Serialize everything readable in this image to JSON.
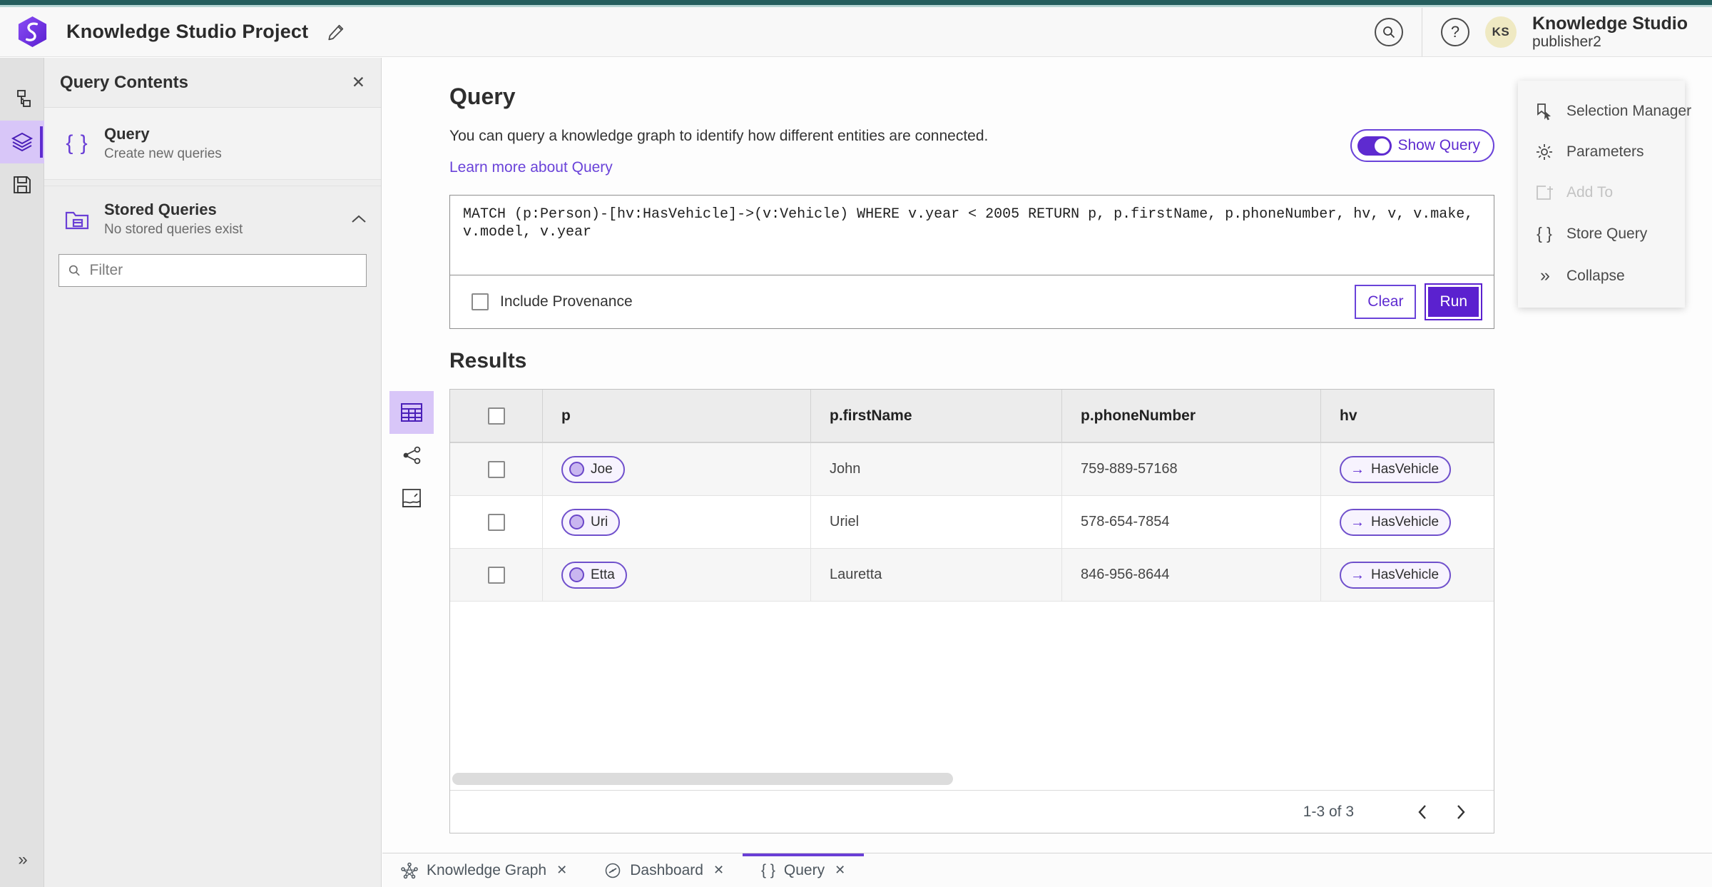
{
  "header": {
    "app_title": "Knowledge Studio Project",
    "user": {
      "initials": "KS",
      "org": "Knowledge Studio",
      "name": "publisher2"
    }
  },
  "panel": {
    "title": "Query Contents",
    "items": [
      {
        "title": "Query",
        "subtitle": "Create new queries"
      },
      {
        "title": "Stored Queries",
        "subtitle": "No stored queries exist"
      }
    ],
    "filter_placeholder": "Filter"
  },
  "query_section": {
    "title": "Query",
    "description": "You can query a knowledge graph to identify how different entities are connected.",
    "link_label": "Learn more about Query",
    "show_query_label": "Show Query",
    "query_text": "MATCH (p:Person)-[hv:HasVehicle]->(v:Vehicle) WHERE v.year < 2005 RETURN p, p.firstName, p.phoneNumber, hv, v, v.make, v.model, v.year",
    "include_provenance_label": "Include Provenance",
    "clear_label": "Clear",
    "run_label": "Run"
  },
  "results": {
    "title": "Results",
    "table": {
      "columns": [
        "p",
        "p.firstName",
        "p.phoneNumber",
        "hv"
      ],
      "rows": [
        {
          "p": "Joe",
          "firstName": "John",
          "phoneNumber": "759-889-57168",
          "hv": "HasVehicle"
        },
        {
          "p": "Uri",
          "firstName": "Uriel",
          "phoneNumber": "578-654-7854",
          "hv": "HasVehicle"
        },
        {
          "p": "Etta",
          "firstName": "Lauretta",
          "phoneNumber": "846-956-8644",
          "hv": "HasVehicle"
        }
      ]
    },
    "pagination": {
      "range": "1-3 of 3"
    }
  },
  "right_panel": {
    "items": [
      {
        "label": "Selection Manager",
        "disabled": false
      },
      {
        "label": "Parameters",
        "disabled": false
      },
      {
        "label": "Add To",
        "disabled": true
      },
      {
        "label": "Store Query",
        "disabled": false
      },
      {
        "label": "Collapse",
        "disabled": false
      }
    ]
  },
  "bottom_tabs": [
    {
      "label": "Knowledge Graph",
      "active": false
    },
    {
      "label": "Dashboard",
      "active": false
    },
    {
      "label": "Query",
      "active": true
    }
  ],
  "icons": {
    "braces": "{ }",
    "arrow_right": "→",
    "close": "✕",
    "double_chevron_right": "»",
    "help": "?"
  },
  "colors": {
    "accent_purple": "#5e2bd0",
    "accent_purple_light": "#d8c6f8",
    "top_strip_teal": "#255e5e",
    "top_strip_teal_light": "#b7d6d5",
    "avatar_bg": "#efe9c2",
    "run_button": "#5b21cf"
  }
}
